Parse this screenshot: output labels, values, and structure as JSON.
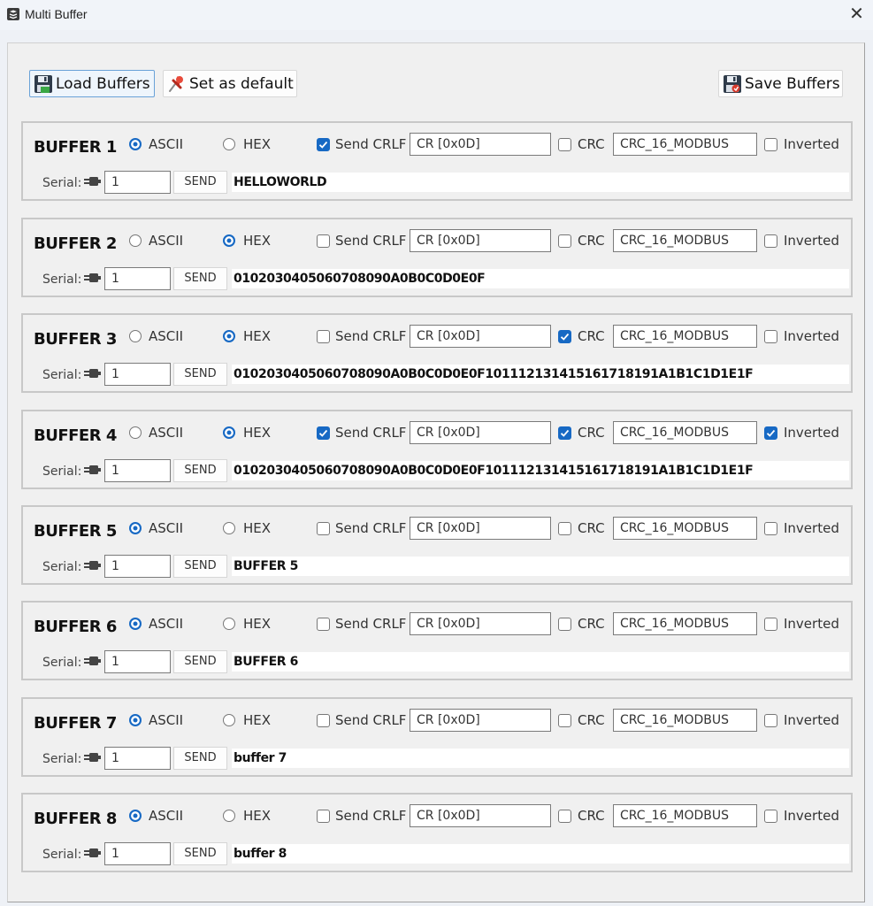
{
  "window": {
    "title": "Multi Buffer",
    "app_icon": "stacked-layers-icon",
    "close_symbol": "✕"
  },
  "toolbar": {
    "load_label": "Load Buffers",
    "load_icon": "floppy-disk-icon",
    "default_label": "Set as default",
    "default_icon": "pushpin-icon",
    "save_label": "Save Buffers",
    "save_icon": "floppy-disk-save-icon"
  },
  "labels": {
    "ascii": "ASCII",
    "hex": "HEX",
    "send_crlf": "Send CRLF",
    "crc": "CRC",
    "inverted": "Inverted",
    "serial": "Serial:",
    "send": "SEND"
  },
  "colors": {
    "accent": "#1769c4"
  },
  "buffers": [
    {
      "title": "BUFFER 1",
      "mode": "ASCII",
      "send_crlf": true,
      "crlf_value": "CR [0x0D]",
      "crc": false,
      "crc_type": "CRC_16_MODBUS",
      "inverted": false,
      "port": "1",
      "data": "HELLOWORLD"
    },
    {
      "title": "BUFFER 2",
      "mode": "HEX",
      "send_crlf": false,
      "crlf_value": "CR [0x0D]",
      "crc": false,
      "crc_type": "CRC_16_MODBUS",
      "inverted": false,
      "port": "1",
      "data": "0102030405060708090A0B0C0D0E0F"
    },
    {
      "title": "BUFFER 3",
      "mode": "HEX",
      "send_crlf": false,
      "crlf_value": "CR [0x0D]",
      "crc": true,
      "crc_type": "CRC_16_MODBUS",
      "inverted": false,
      "port": "1",
      "data": "0102030405060708090A0B0C0D0E0F101112131415161718191A1B1C1D1E1F"
    },
    {
      "title": "BUFFER 4",
      "mode": "HEX",
      "send_crlf": true,
      "crlf_value": "CR [0x0D]",
      "crc": true,
      "crc_type": "CRC_16_MODBUS",
      "inverted": true,
      "port": "1",
      "data": "0102030405060708090A0B0C0D0E0F101112131415161718191A1B1C1D1E1F"
    },
    {
      "title": "BUFFER 5",
      "mode": "ASCII",
      "send_crlf": false,
      "crlf_value": "CR [0x0D]",
      "crc": false,
      "crc_type": "CRC_16_MODBUS",
      "inverted": false,
      "port": "1",
      "data": "BUFFER 5"
    },
    {
      "title": "BUFFER 6",
      "mode": "ASCII",
      "send_crlf": false,
      "crlf_value": "CR [0x0D]",
      "crc": false,
      "crc_type": "CRC_16_MODBUS",
      "inverted": false,
      "port": "1",
      "data": "BUFFER 6"
    },
    {
      "title": "BUFFER 7",
      "mode": "ASCII",
      "send_crlf": false,
      "crlf_value": "CR [0x0D]",
      "crc": false,
      "crc_type": "CRC_16_MODBUS",
      "inverted": false,
      "port": "1",
      "data": "buffer 7"
    },
    {
      "title": "BUFFER 8",
      "mode": "ASCII",
      "send_crlf": false,
      "crlf_value": "CR [0x0D]",
      "crc": false,
      "crc_type": "CRC_16_MODBUS",
      "inverted": false,
      "port": "1",
      "data": "buffer 8"
    }
  ]
}
